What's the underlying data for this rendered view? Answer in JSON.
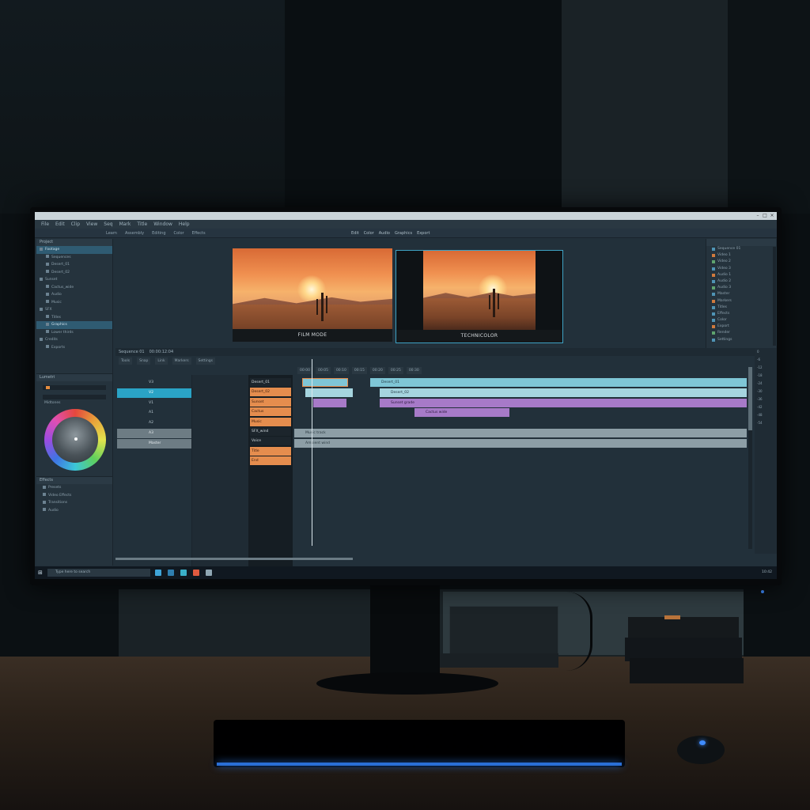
{
  "window": {
    "menu": [
      "File",
      "Edit",
      "Clip",
      "View",
      "Seq",
      "Mark",
      "Title",
      "Window",
      "Help"
    ],
    "toolbar_left": [
      "Learn",
      "Assembly",
      "Editing",
      "Color",
      "Effects"
    ],
    "toolbar_center": [
      "Edit",
      "Color",
      "Audio",
      "Graphics",
      "Export"
    ]
  },
  "project_panel": {
    "title": "Project",
    "items": [
      {
        "label": "Footage",
        "selected": true
      },
      {
        "label": "Sequences",
        "selected": false
      },
      {
        "label": "Desert_01",
        "selected": false
      },
      {
        "label": "Desert_02",
        "selected": false
      },
      {
        "label": "Sunset",
        "selected": false
      },
      {
        "label": "Cactus_wide",
        "selected": false
      },
      {
        "label": "Audio",
        "selected": false
      },
      {
        "label": "Music",
        "selected": false
      },
      {
        "label": "SFX",
        "selected": false
      },
      {
        "label": "Titles",
        "selected": false
      },
      {
        "label": "Graphics",
        "selected": true
      },
      {
        "label": "Lower thirds",
        "selected": false
      },
      {
        "label": "Credits",
        "selected": false
      },
      {
        "label": "Exports",
        "selected": false
      }
    ]
  },
  "color_panel": {
    "title": "Lumetri",
    "wheel_label": "Midtones"
  },
  "effects_panel": {
    "title": "Effects",
    "items": [
      "Presets",
      "Video Effects",
      "Transitions",
      "Audio"
    ]
  },
  "program_monitor": {
    "left_caption": "FILM MODE",
    "right_caption": "TECHNICOLOR"
  },
  "inspector": {
    "items": [
      "Sequence 01",
      "Video 1",
      "Video 2",
      "Video 3",
      "Audio 1",
      "Audio 2",
      "Audio 3",
      "Master",
      "Markers",
      "Titles",
      "Effects",
      "Color",
      "Export",
      "Render",
      "Settings"
    ]
  },
  "timeline": {
    "header": [
      "Sequence 01",
      "00:00:12:04"
    ],
    "tabs": [
      "Tools",
      "Snap",
      "Link",
      "Markers",
      "Settings"
    ],
    "ruler": [
      "00:00",
      "00:05",
      "00:10",
      "00:15",
      "00:20",
      "00:25",
      "00:30"
    ],
    "tracks": [
      {
        "label": "V3",
        "style": "normal"
      },
      {
        "label": "V2",
        "style": "hl"
      },
      {
        "label": "V1",
        "style": "normal"
      },
      {
        "label": "A1",
        "style": "normal"
      },
      {
        "label": "A2",
        "style": "normal"
      },
      {
        "label": "A3",
        "style": "gray"
      },
      {
        "label": "Master",
        "style": "gray"
      }
    ],
    "clip_column": [
      {
        "label": "Desert_01",
        "dark": true
      },
      {
        "label": "Desert_02",
        "dark": false
      },
      {
        "label": "Sunset",
        "dark": false
      },
      {
        "label": "Cactus",
        "dark": false
      },
      {
        "label": "Music",
        "dark": false
      },
      {
        "label": "SFX_wind",
        "dark": true
      },
      {
        "label": "Voice",
        "dark": true
      },
      {
        "label": "Title",
        "dark": false
      },
      {
        "label": "End",
        "dark": false
      }
    ],
    "clips": [
      {
        "label": "Desert_01",
        "color": "cyan",
        "row": 0
      },
      {
        "label": "Desert_02",
        "color": "lblue",
        "row": 1
      },
      {
        "label": "Sunset grade",
        "color": "purple",
        "row": 2
      },
      {
        "label": "Cactus wide",
        "color": "purple",
        "row": 3
      },
      {
        "label": "Music track",
        "color": "gray",
        "row": 5
      },
      {
        "label": "Ambient wind",
        "color": "gray",
        "row": 6
      }
    ],
    "meters": [
      "0",
      "-6",
      "-12",
      "-18",
      "-24",
      "-30",
      "-36",
      "-42",
      "-48",
      "-54"
    ]
  },
  "taskbar": {
    "search_placeholder": "Type here to search",
    "time": "10:42"
  }
}
